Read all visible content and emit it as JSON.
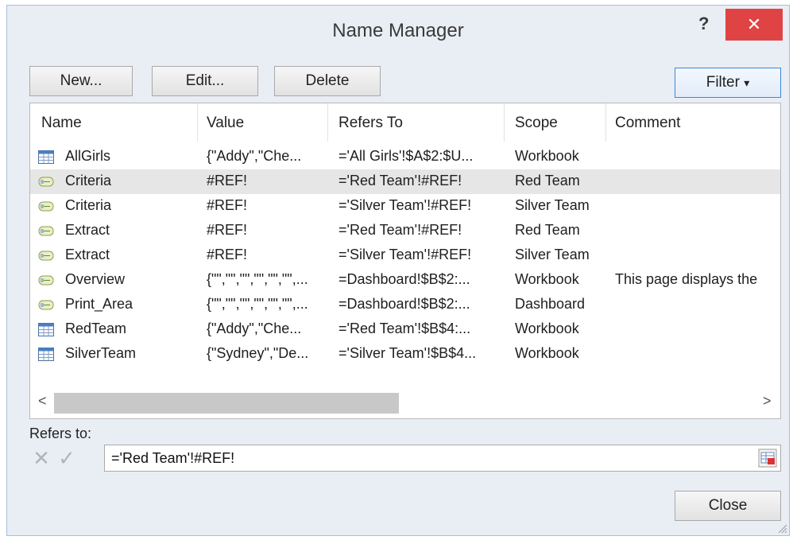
{
  "dialog": {
    "title": "Name Manager",
    "help": "?",
    "close_x": "✕"
  },
  "toolbar": {
    "new_label": "New...",
    "edit_label": "Edit...",
    "delete_label": "Delete",
    "filter_label": "Filter",
    "filter_arrow": "▾"
  },
  "columns": [
    "Name",
    "Value",
    "Refers To",
    "Scope",
    "Comment"
  ],
  "rows": [
    {
      "icon": "table-icon",
      "name": "AllGirls",
      "value": "{\"Addy\",\"Che...",
      "refers_to": "='All Girls'!$A$2:$U...",
      "scope": "Workbook",
      "comment": ""
    },
    {
      "icon": "named-range-icon",
      "name": "Criteria",
      "value": "#REF!",
      "refers_to": "='Red Team'!#REF!",
      "scope": "Red Team",
      "comment": "",
      "selected": true
    },
    {
      "icon": "named-range-icon",
      "name": "Criteria",
      "value": "#REF!",
      "refers_to": "='Silver Team'!#REF!",
      "scope": "Silver Team",
      "comment": ""
    },
    {
      "icon": "named-range-icon",
      "name": "Extract",
      "value": "#REF!",
      "refers_to": "='Red Team'!#REF!",
      "scope": "Red Team",
      "comment": ""
    },
    {
      "icon": "named-range-icon",
      "name": "Extract",
      "value": "#REF!",
      "refers_to": "='Silver Team'!#REF!",
      "scope": "Silver Team",
      "comment": ""
    },
    {
      "icon": "named-range-icon",
      "name": "Overview",
      "value": "{\"\",\"\",\"\",\"\",\"\",\"\",...",
      "refers_to": "=Dashboard!$B$2:...",
      "scope": "Workbook",
      "comment": "This page displays the"
    },
    {
      "icon": "named-range-icon",
      "name": "Print_Area",
      "value": "{\"\",\"\",\"\",\"\",\"\",\"\",...",
      "refers_to": "=Dashboard!$B$2:...",
      "scope": "Dashboard",
      "comment": ""
    },
    {
      "icon": "table-icon",
      "name": "RedTeam",
      "value": "{\"Addy\",\"Che...",
      "refers_to": "='Red Team'!$B$4:...",
      "scope": "Workbook",
      "comment": ""
    },
    {
      "icon": "table-icon",
      "name": "SilverTeam",
      "value": "{\"Sydney\",\"De...",
      "refers_to": "='Silver Team'!$B$4...",
      "scope": "Workbook",
      "comment": ""
    }
  ],
  "scroll": {
    "left_arrow": "<",
    "right_arrow": ">"
  },
  "refers_to": {
    "label": "Refers to:",
    "value": "='Red Team'!#REF!"
  },
  "close_label": "Close",
  "colors": {
    "title_close": "#e04343",
    "selected_row": "#e6e6e6",
    "filter_border": "#3c86d6"
  }
}
